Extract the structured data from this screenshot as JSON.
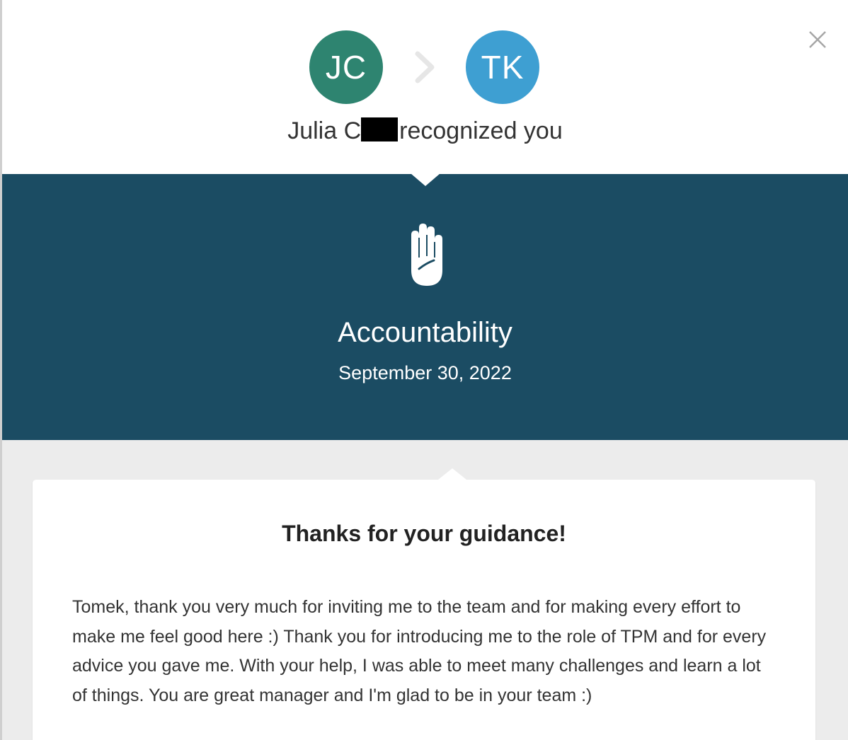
{
  "sender": {
    "initials": "JC",
    "name": "Julia C",
    "avatar_color": "#2e8470"
  },
  "recipient": {
    "initials": "TK",
    "avatar_color": "#3e9fd2"
  },
  "headline_suffix": "recognized you",
  "value": {
    "title": "Accountability",
    "date": "September 30, 2022",
    "icon": "raised-hand-icon"
  },
  "banner_color": "#1b4c63",
  "message": {
    "title": "Thanks for your guidance!",
    "body": "Tomek, thank you very much for inviting me to the team and for making every effort to make me feel good here :) Thank you for introducing me to the role of TPM and for every advice you gave me. With your help, I was able to meet many challenges and learn a lot of things. You are great manager and I'm glad to be in your team :)"
  },
  "icons": {
    "separator": "chevron-right-icon",
    "close": "close-icon"
  }
}
